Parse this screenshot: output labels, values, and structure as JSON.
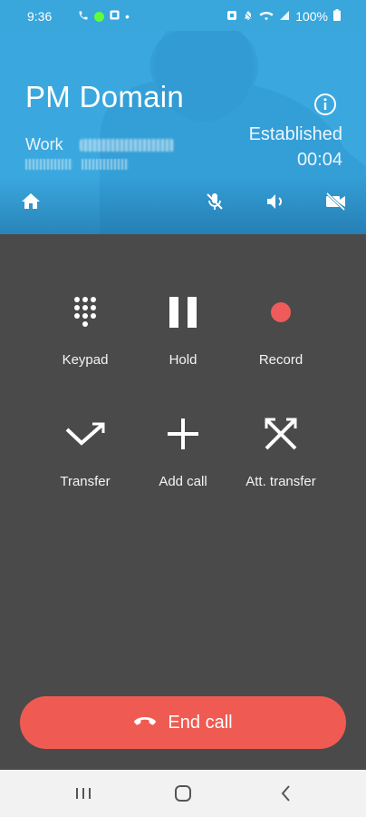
{
  "status_bar": {
    "time": "9:36",
    "battery": "100%"
  },
  "call": {
    "contact_name": "PM Domain",
    "number_label": "Work",
    "state": "Established",
    "duration": "00:04"
  },
  "actions": [
    {
      "label": "Keypad",
      "icon": "keypad-icon"
    },
    {
      "label": "Hold",
      "icon": "pause-icon"
    },
    {
      "label": "Record",
      "icon": "record-icon"
    },
    {
      "label": "Transfer",
      "icon": "transfer-icon"
    },
    {
      "label": "Add call",
      "icon": "plus-icon"
    },
    {
      "label": "Att. transfer",
      "icon": "attended-transfer-icon"
    }
  ],
  "end_call": {
    "label": "End call"
  },
  "colors": {
    "header": "#3aa8de",
    "background": "#4a4a4a",
    "end_call": "#ef5b52",
    "record": "#ef5b5b"
  }
}
